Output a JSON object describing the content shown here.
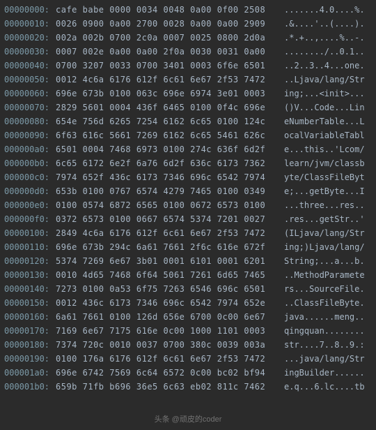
{
  "watermark": "头条 @顽皮的coder",
  "rows": [
    {
      "addr": "00000000:",
      "hex": "cafe babe 0000 0034 0048 0a00 0f00 2508",
      "asc": ".......4.0....%."
    },
    {
      "addr": "00000010:",
      "hex": "0026 0900 0a00 2700 0028 0a00 0a00 2909",
      "asc": ".&....'..(....)."
    },
    {
      "addr": "00000020:",
      "hex": "002a 002b 0700 2c0a 0007 0025 0800 2d0a",
      "asc": ".*.+..,....%..-."
    },
    {
      "addr": "00000030:",
      "hex": "0007 002e 0a00 0a00 2f0a 0030 0031 0a00",
      "asc": "......../..0.1.."
    },
    {
      "addr": "00000040:",
      "hex": "0700 3207 0033 0700 3401 0003 6f6e 6501",
      "asc": "..2..3..4...one."
    },
    {
      "addr": "00000050:",
      "hex": "0012 4c6a 6176 612f 6c61 6e67 2f53 7472",
      "asc": "..Ljava/lang/Str"
    },
    {
      "addr": "00000060:",
      "hex": "696e 673b 0100 063c 696e 6974 3e01 0003",
      "asc": "ing;...<init>..."
    },
    {
      "addr": "00000070:",
      "hex": "2829 5601 0004 436f 6465 0100 0f4c 696e",
      "asc": "()V...Code...Lin"
    },
    {
      "addr": "00000080:",
      "hex": "654e 756d 6265 7254 6162 6c65 0100 124c",
      "asc": "eNumberTable...L"
    },
    {
      "addr": "00000090:",
      "hex": "6f63 616c 5661 7269 6162 6c65 5461 626c",
      "asc": "ocalVariableTabl"
    },
    {
      "addr": "000000a0:",
      "hex": "6501 0004 7468 6973 0100 274c 636f 6d2f",
      "asc": "e...this..'Lcom/"
    },
    {
      "addr": "000000b0:",
      "hex": "6c65 6172 6e2f 6a76 6d2f 636c 6173 7362",
      "asc": "learn/jvm/classb"
    },
    {
      "addr": "000000c0:",
      "hex": "7974 652f 436c 6173 7346 696c 6542 7974",
      "asc": "yte/ClassFileByt"
    },
    {
      "addr": "000000d0:",
      "hex": "653b 0100 0767 6574 4279 7465 0100 0349",
      "asc": "e;...getByte...I"
    },
    {
      "addr": "000000e0:",
      "hex": "0100 0574 6872 6565 0100 0672 6573 0100",
      "asc": "...three...res.."
    },
    {
      "addr": "000000f0:",
      "hex": "0372 6573 0100 0667 6574 5374 7201 0027",
      "asc": ".res...getStr..'"
    },
    {
      "addr": "00000100:",
      "hex": "2849 4c6a 6176 612f 6c61 6e67 2f53 7472",
      "asc": "(ILjava/lang/Str"
    },
    {
      "addr": "00000110:",
      "hex": "696e 673b 294c 6a61 7661 2f6c 616e 672f",
      "asc": "ing;)Ljava/lang/"
    },
    {
      "addr": "00000120:",
      "hex": "5374 7269 6e67 3b01 0001 6101 0001 6201",
      "asc": "String;...a...b."
    },
    {
      "addr": "00000130:",
      "hex": "0010 4d65 7468 6f64 5061 7261 6d65 7465",
      "asc": "..MethodParamete"
    },
    {
      "addr": "00000140:",
      "hex": "7273 0100 0a53 6f75 7263 6546 696c 6501",
      "asc": "rs...SourceFile."
    },
    {
      "addr": "00000150:",
      "hex": "0012 436c 6173 7346 696c 6542 7974 652e",
      "asc": "..ClassFileByte."
    },
    {
      "addr": "00000160:",
      "hex": "6a61 7661 0100 126d 656e 6700 0c00 6e67",
      "asc": "java......meng.."
    },
    {
      "addr": "00000170:",
      "hex": "7169 6e67 7175 616e 0c00 1000 1101 0003",
      "asc": "qingquan........"
    },
    {
      "addr": "00000180:",
      "hex": "7374 720c 0010 0037 0700 380c 0039 003a",
      "asc": "str....7..8..9.:"
    },
    {
      "addr": "00000190:",
      "hex": "0100 176a 6176 612f 6c61 6e67 2f53 7472",
      "asc": "...java/lang/Str"
    },
    {
      "addr": "000001a0:",
      "hex": "696e 6742 7569 6c64 6572 0c00 bc02 bf94",
      "asc": "ingBuilder......"
    },
    {
      "addr": "000001b0:",
      "hex": "659b 71fb b696 36e5 6c63 eb02 811c 7462",
      "asc": "e.q...6.lc....tb"
    }
  ]
}
